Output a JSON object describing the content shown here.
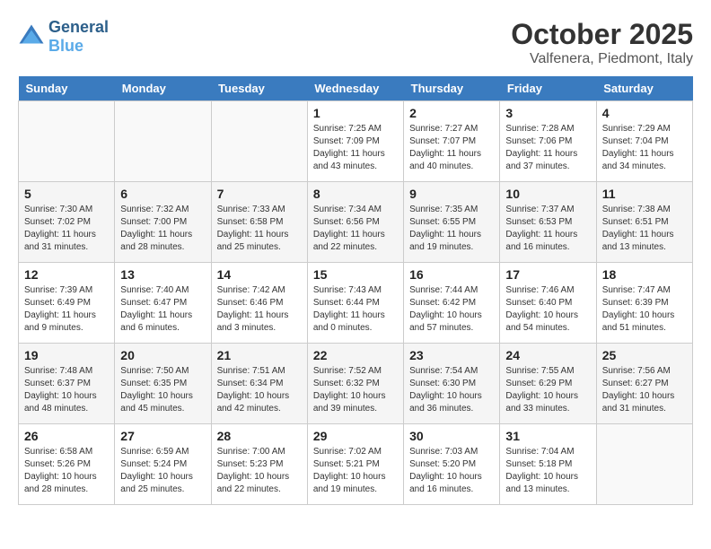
{
  "header": {
    "logo_line1": "General",
    "logo_line2": "Blue",
    "month": "October 2025",
    "location": "Valfenera, Piedmont, Italy"
  },
  "weekdays": [
    "Sunday",
    "Monday",
    "Tuesday",
    "Wednesday",
    "Thursday",
    "Friday",
    "Saturday"
  ],
  "weeks": [
    [
      {
        "day": "",
        "info": ""
      },
      {
        "day": "",
        "info": ""
      },
      {
        "day": "",
        "info": ""
      },
      {
        "day": "1",
        "info": "Sunrise: 7:25 AM\nSunset: 7:09 PM\nDaylight: 11 hours\nand 43 minutes."
      },
      {
        "day": "2",
        "info": "Sunrise: 7:27 AM\nSunset: 7:07 PM\nDaylight: 11 hours\nand 40 minutes."
      },
      {
        "day": "3",
        "info": "Sunrise: 7:28 AM\nSunset: 7:06 PM\nDaylight: 11 hours\nand 37 minutes."
      },
      {
        "day": "4",
        "info": "Sunrise: 7:29 AM\nSunset: 7:04 PM\nDaylight: 11 hours\nand 34 minutes."
      }
    ],
    [
      {
        "day": "5",
        "info": "Sunrise: 7:30 AM\nSunset: 7:02 PM\nDaylight: 11 hours\nand 31 minutes."
      },
      {
        "day": "6",
        "info": "Sunrise: 7:32 AM\nSunset: 7:00 PM\nDaylight: 11 hours\nand 28 minutes."
      },
      {
        "day": "7",
        "info": "Sunrise: 7:33 AM\nSunset: 6:58 PM\nDaylight: 11 hours\nand 25 minutes."
      },
      {
        "day": "8",
        "info": "Sunrise: 7:34 AM\nSunset: 6:56 PM\nDaylight: 11 hours\nand 22 minutes."
      },
      {
        "day": "9",
        "info": "Sunrise: 7:35 AM\nSunset: 6:55 PM\nDaylight: 11 hours\nand 19 minutes."
      },
      {
        "day": "10",
        "info": "Sunrise: 7:37 AM\nSunset: 6:53 PM\nDaylight: 11 hours\nand 16 minutes."
      },
      {
        "day": "11",
        "info": "Sunrise: 7:38 AM\nSunset: 6:51 PM\nDaylight: 11 hours\nand 13 minutes."
      }
    ],
    [
      {
        "day": "12",
        "info": "Sunrise: 7:39 AM\nSunset: 6:49 PM\nDaylight: 11 hours\nand 9 minutes."
      },
      {
        "day": "13",
        "info": "Sunrise: 7:40 AM\nSunset: 6:47 PM\nDaylight: 11 hours\nand 6 minutes."
      },
      {
        "day": "14",
        "info": "Sunrise: 7:42 AM\nSunset: 6:46 PM\nDaylight: 11 hours\nand 3 minutes."
      },
      {
        "day": "15",
        "info": "Sunrise: 7:43 AM\nSunset: 6:44 PM\nDaylight: 11 hours\nand 0 minutes."
      },
      {
        "day": "16",
        "info": "Sunrise: 7:44 AM\nSunset: 6:42 PM\nDaylight: 10 hours\nand 57 minutes."
      },
      {
        "day": "17",
        "info": "Sunrise: 7:46 AM\nSunset: 6:40 PM\nDaylight: 10 hours\nand 54 minutes."
      },
      {
        "day": "18",
        "info": "Sunrise: 7:47 AM\nSunset: 6:39 PM\nDaylight: 10 hours\nand 51 minutes."
      }
    ],
    [
      {
        "day": "19",
        "info": "Sunrise: 7:48 AM\nSunset: 6:37 PM\nDaylight: 10 hours\nand 48 minutes."
      },
      {
        "day": "20",
        "info": "Sunrise: 7:50 AM\nSunset: 6:35 PM\nDaylight: 10 hours\nand 45 minutes."
      },
      {
        "day": "21",
        "info": "Sunrise: 7:51 AM\nSunset: 6:34 PM\nDaylight: 10 hours\nand 42 minutes."
      },
      {
        "day": "22",
        "info": "Sunrise: 7:52 AM\nSunset: 6:32 PM\nDaylight: 10 hours\nand 39 minutes."
      },
      {
        "day": "23",
        "info": "Sunrise: 7:54 AM\nSunset: 6:30 PM\nDaylight: 10 hours\nand 36 minutes."
      },
      {
        "day": "24",
        "info": "Sunrise: 7:55 AM\nSunset: 6:29 PM\nDaylight: 10 hours\nand 33 minutes."
      },
      {
        "day": "25",
        "info": "Sunrise: 7:56 AM\nSunset: 6:27 PM\nDaylight: 10 hours\nand 31 minutes."
      }
    ],
    [
      {
        "day": "26",
        "info": "Sunrise: 6:58 AM\nSunset: 5:26 PM\nDaylight: 10 hours\nand 28 minutes."
      },
      {
        "day": "27",
        "info": "Sunrise: 6:59 AM\nSunset: 5:24 PM\nDaylight: 10 hours\nand 25 minutes."
      },
      {
        "day": "28",
        "info": "Sunrise: 7:00 AM\nSunset: 5:23 PM\nDaylight: 10 hours\nand 22 minutes."
      },
      {
        "day": "29",
        "info": "Sunrise: 7:02 AM\nSunset: 5:21 PM\nDaylight: 10 hours\nand 19 minutes."
      },
      {
        "day": "30",
        "info": "Sunrise: 7:03 AM\nSunset: 5:20 PM\nDaylight: 10 hours\nand 16 minutes."
      },
      {
        "day": "31",
        "info": "Sunrise: 7:04 AM\nSunset: 5:18 PM\nDaylight: 10 hours\nand 13 minutes."
      },
      {
        "day": "",
        "info": ""
      }
    ]
  ]
}
